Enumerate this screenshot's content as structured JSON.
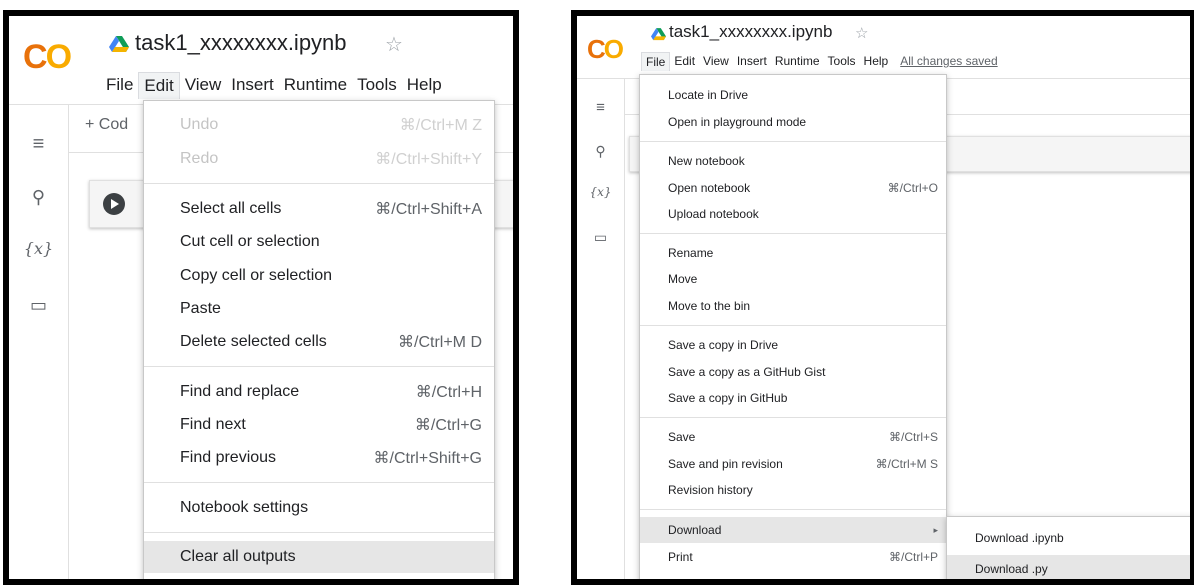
{
  "left": {
    "logo": "CO",
    "title": "task1_xxxxxxxx.ipynb",
    "star": "☆",
    "menus": [
      "File",
      "Edit",
      "View",
      "Insert",
      "Runtime",
      "Tools",
      "Help"
    ],
    "active_menu": "Edit",
    "add_code": "+ Cod",
    "sidebar_icons": [
      "≡",
      "⚲",
      "{x}",
      "▭"
    ],
    "edit_menu": [
      {
        "label": "Undo",
        "shortcut": "⌘/Ctrl+M Z",
        "disabled": true
      },
      {
        "label": "Redo",
        "shortcut": "⌘/Ctrl+Shift+Y",
        "disabled": true
      },
      {
        "label": "Select all cells",
        "shortcut": "⌘/Ctrl+Shift+A"
      },
      {
        "label": "Cut cell or selection",
        "shortcut": ""
      },
      {
        "label": "Copy cell or selection",
        "shortcut": ""
      },
      {
        "label": "Paste",
        "shortcut": ""
      },
      {
        "label": "Delete selected cells",
        "shortcut": "⌘/Ctrl+M D"
      },
      {
        "label": "Find and replace",
        "shortcut": "⌘/Ctrl+H"
      },
      {
        "label": "Find next",
        "shortcut": "⌘/Ctrl+G"
      },
      {
        "label": "Find previous",
        "shortcut": "⌘/Ctrl+Shift+G"
      },
      {
        "label": "Notebook settings",
        "shortcut": ""
      },
      {
        "label": "Clear all outputs",
        "shortcut": "",
        "highlighted": true
      }
    ]
  },
  "right": {
    "logo": "CO",
    "title": "task1_xxxxxxxx.ipynb",
    "star": "☆",
    "menus": [
      "File",
      "Edit",
      "View",
      "Insert",
      "Runtime",
      "Tools",
      "Help"
    ],
    "active_menu": "File",
    "saved_status": "All changes saved",
    "sidebar_icons": [
      "≡",
      "⚲",
      "{x}",
      "▭"
    ],
    "file_menu": [
      {
        "label": "Locate in Drive",
        "shortcut": ""
      },
      {
        "label": "Open in playground mode",
        "shortcut": ""
      },
      {
        "label": "New notebook",
        "shortcut": ""
      },
      {
        "label": "Open notebook",
        "shortcut": "⌘/Ctrl+O"
      },
      {
        "label": "Upload notebook",
        "shortcut": ""
      },
      {
        "label": "Rename",
        "shortcut": ""
      },
      {
        "label": "Move",
        "shortcut": ""
      },
      {
        "label": "Move to the bin",
        "shortcut": ""
      },
      {
        "label": "Save a copy in Drive",
        "shortcut": ""
      },
      {
        "label": "Save a copy as a GitHub Gist",
        "shortcut": ""
      },
      {
        "label": "Save a copy in GitHub",
        "shortcut": ""
      },
      {
        "label": "Save",
        "shortcut": "⌘/Ctrl+S"
      },
      {
        "label": "Save and pin revision",
        "shortcut": "⌘/Ctrl+M S"
      },
      {
        "label": "Revision history",
        "shortcut": ""
      },
      {
        "label": "Download",
        "shortcut": "▸",
        "highlighted": true
      },
      {
        "label": "Print",
        "shortcut": "⌘/Ctrl+P"
      }
    ],
    "download_submenu": [
      {
        "label": "Download .ipynb"
      },
      {
        "label": "Download .py",
        "highlighted": true
      }
    ]
  },
  "colors": {
    "logo_orange": "#e8710a",
    "logo_yellow": "#f9ab00",
    "highlight": "#e6e6e6",
    "disabled_text": "#c4c4c4"
  }
}
